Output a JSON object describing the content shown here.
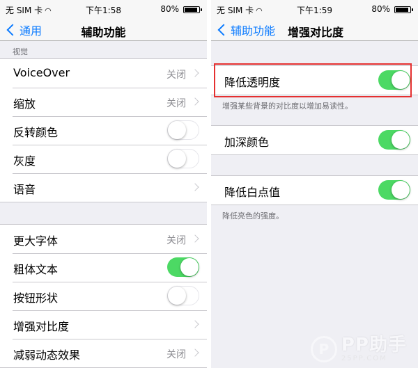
{
  "status_left": {
    "carrier": "无 SIM 卡",
    "wifi": "📶",
    "time": "下午1:58",
    "battery": "80%",
    "battery_level": 0.8
  },
  "status_right": {
    "carrier": "无 SIM 卡",
    "wifi": "📶",
    "time": "下午1:59",
    "battery": "80%",
    "battery_level": 0.8
  },
  "left": {
    "back": "通用",
    "title": "辅助功能",
    "section_header": "视觉",
    "group1": [
      {
        "label": "VoiceOver",
        "value": "关闭"
      },
      {
        "label": "缩放",
        "value": "关闭"
      },
      {
        "label": "反转颜色",
        "toggle": "off"
      },
      {
        "label": "灰度",
        "toggle": "off"
      },
      {
        "label": "语音"
      }
    ],
    "group2": [
      {
        "label": "更大字体",
        "value": "关闭"
      },
      {
        "label": "粗体文本",
        "toggle": "on"
      },
      {
        "label": "按钮形状",
        "toggle": "off"
      },
      {
        "label": "增强对比度"
      },
      {
        "label": "减弱动态效果",
        "value": "关闭"
      }
    ]
  },
  "right": {
    "back": "辅助功能",
    "title": "增强对比度",
    "reduce_transparency": {
      "label": "降低透明度",
      "toggle": "on"
    },
    "reduce_transparency_footer": "增强某些背景的对比度以增加易读性。",
    "darken_colors": {
      "label": "加深颜色",
      "toggle": "on"
    },
    "reduce_white_point": {
      "label": "降低白点值",
      "toggle": "on"
    },
    "reduce_white_point_footer": "降低亮色的强度。"
  },
  "watermark": {
    "brand": "PP助手",
    "url": "25PP.COM",
    "logo": "P"
  },
  "colors": {
    "accent": "#0a7aff",
    "toggle_on": "#4cd964",
    "highlight": "#e53030"
  }
}
